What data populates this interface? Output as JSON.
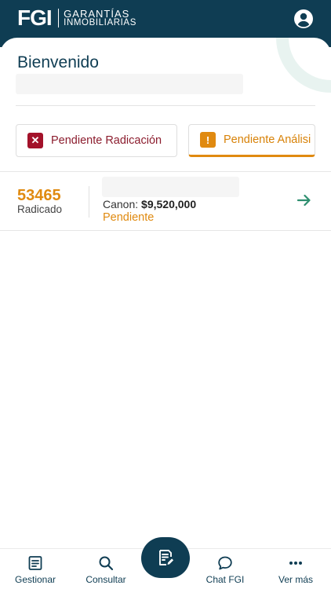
{
  "brand": {
    "mark": "FGI",
    "line1": "GARANTÍAS",
    "line2": "INMOBILIARIAS"
  },
  "welcome": "Bienvenido",
  "filters": [
    {
      "label": "Pendiente Radicación",
      "icon": "x-icon",
      "color": "#a3122a",
      "icon_glyph": "✕"
    },
    {
      "label": "Pendiente Análisi",
      "icon": "warning-icon",
      "color": "#e08a10",
      "icon_glyph": "!"
    }
  ],
  "records": [
    {
      "number": "53465",
      "status": "Radicado",
      "canon_label": "Canon:",
      "canon_value": "$9,520,000",
      "state": "Pendiente"
    }
  ],
  "nav": [
    {
      "label": "Gestionar",
      "icon": "document-list-icon"
    },
    {
      "label": "Consultar",
      "icon": "search-icon"
    },
    {
      "label": "",
      "icon": "document-edit-icon"
    },
    {
      "label": "Chat FGI",
      "icon": "chat-icon"
    },
    {
      "label": "Ver más",
      "icon": "more-dots-icon"
    }
  ],
  "colors": {
    "primary": "#0f3d53",
    "accent_orange": "#e08a10",
    "accent_red": "#a3122a",
    "arrow_green": "#2e8f6f"
  }
}
